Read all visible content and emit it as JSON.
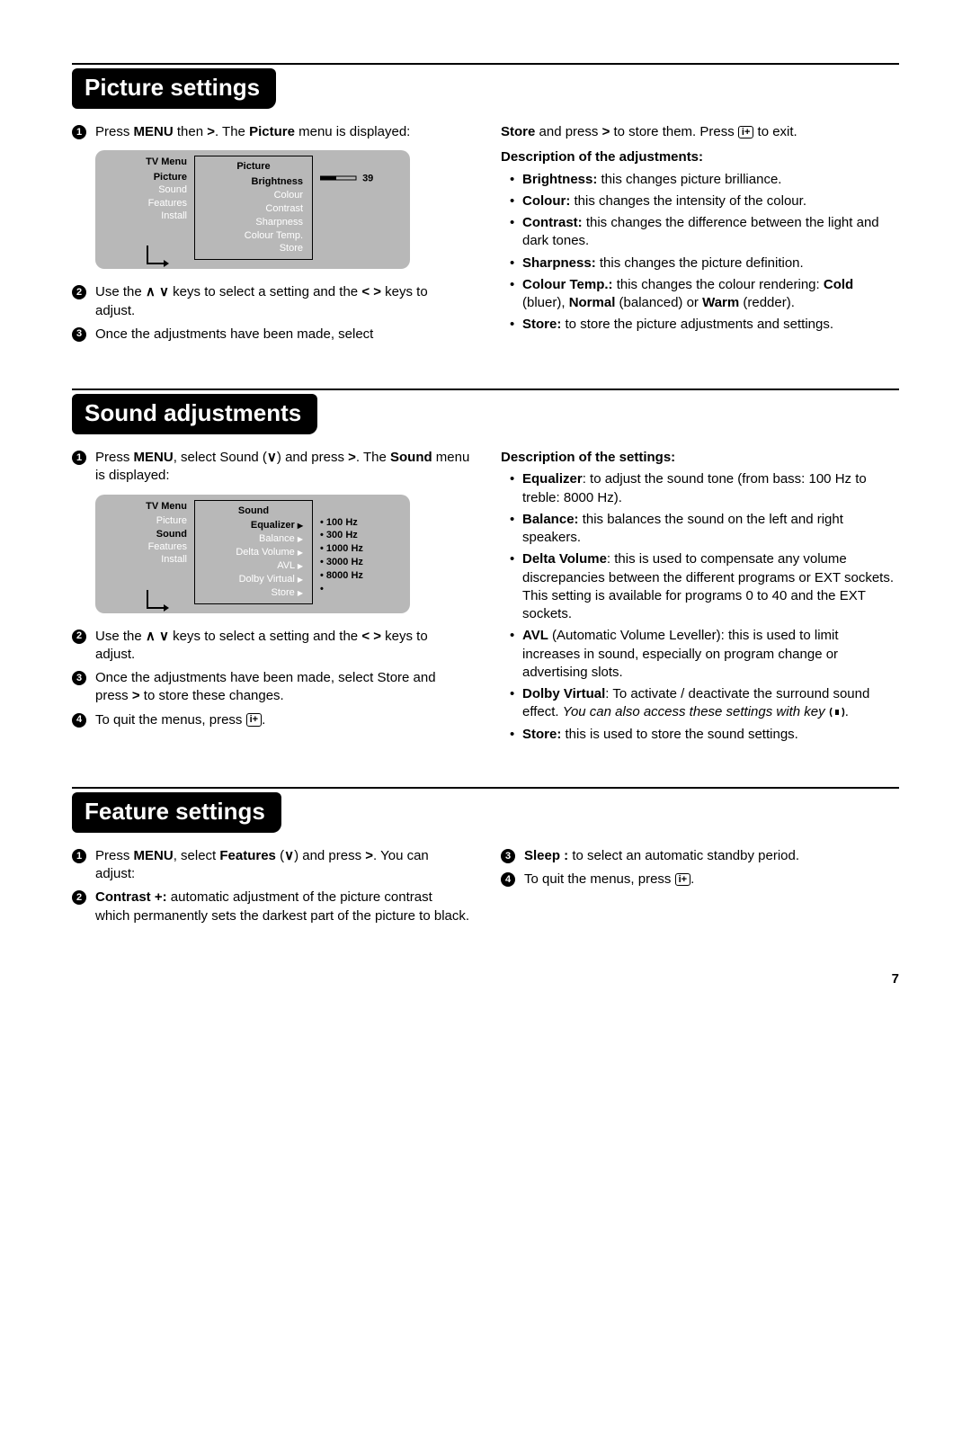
{
  "page_number": "7",
  "sections": {
    "picture": {
      "title": "Picture settings",
      "step1_a": "Press ",
      "step1_menu": "MENU",
      "step1_b": " then ",
      "step1_c": ". The ",
      "step1_picture": "Picture",
      "step1_d": " menu is displayed:",
      "osd": {
        "left_head": "TV Menu",
        "left_items": [
          "Picture",
          "Sound",
          "Features",
          "Install"
        ],
        "mid_head": "Picture",
        "mid_items": [
          "Brightness",
          "Colour",
          "Contrast",
          "Sharpness",
          "Colour Temp.",
          "Store"
        ],
        "value": "39"
      },
      "step2_a": "Use the ",
      "step2_b": " keys to select a setting and the ",
      "step2_c": " keys to adjust.",
      "step3": "Once the adjustments have been made, select",
      "step3_cont_a": " and press ",
      "step3_cont_b": " to store them. Press ",
      "step3_cont_c": " to exit.",
      "step3_store": "Store",
      "desc_head": "Description of the adjustments:",
      "desc": {
        "brightness_l": "Brightness:",
        "brightness_t": " this changes picture brilliance.",
        "colour_l": "Colour:",
        "colour_t": " this changes the intensity of the colour.",
        "contrast_l": "Contrast:",
        "contrast_t": " this changes the difference between the light and dark tones.",
        "sharpness_l": "Sharpness:",
        "sharpness_t": " this changes the picture definition.",
        "ctemp_l": "Colour Temp.:",
        "ctemp_t1": " this changes the colour rendering: ",
        "ctemp_cold": "Cold",
        "ctemp_t2": " (bluer), ",
        "ctemp_normal": "Normal",
        "ctemp_t3": " (balanced) or ",
        "ctemp_warm": "Warm",
        "ctemp_t4": " (redder).",
        "store_l": "Store:",
        "store_t": " to store the picture adjustments and settings."
      }
    },
    "sound": {
      "title": "Sound adjustments",
      "step1_a": "Press ",
      "step1_menu": "MENU",
      "step1_b": ", select Sound (",
      "step1_c": ") and press ",
      "step1_d": ". The ",
      "step1_sound": "Sound",
      "step1_e": " menu is displayed:",
      "osd": {
        "left_head": "TV Menu",
        "left_items": [
          "Picture",
          "Sound",
          "Features",
          "Install"
        ],
        "mid_head": "Sound",
        "mid_items": [
          "Equalizer",
          "Balance",
          "Delta Volume",
          "AVL",
          "Dolby Virtual",
          "Store"
        ],
        "hz": [
          "100 Hz",
          "300 Hz",
          "1000 Hz",
          "3000 Hz",
          "8000 Hz"
        ]
      },
      "step2_a": "Use the ",
      "step2_b": " keys to select a setting and the ",
      "step2_c": " keys to adjust.",
      "step3_a": "Once the adjustments have been made, select Store and press ",
      "step3_b": " to store these changes.",
      "step4_a": "To quit the menus, press ",
      "step4_b": ".",
      "desc_head": "Description of the settings:",
      "desc": {
        "eq_l": "Equalizer",
        "eq_t": ": to adjust the sound tone (from bass: 100 Hz to treble: 8000 Hz).",
        "bal_l": "Balance:",
        "bal_t": " this balances the sound on the left and right speakers.",
        "dv_l": "Delta Volume",
        "dv_t": ": this is used to compensate any volume discrepancies between the different programs or EXT sockets. This setting is available for programs 0 to 40 and the EXT sockets.",
        "avl_l": "AVL",
        "avl_t": " (Automatic Volume Leveller): this is used to limit increases in sound, especially on program change or advertising slots.",
        "dolby_l": "Dolby Virtual",
        "dolby_t1": ": To activate / deactivate the surround sound effect. ",
        "dolby_note": "You can also access these settings with key ",
        "dolby_t2": ".",
        "store_l": "Store:",
        "store_t": " this is used to store the sound settings."
      }
    },
    "feature": {
      "title": "Feature settings",
      "step1_a": "Press ",
      "step1_menu": "MENU",
      "step1_b": ", select ",
      "step1_features": "Features",
      "step1_c": " (",
      "step1_d": ") and press ",
      "step1_e": ". You can adjust:",
      "step2_l": "Contrast +:",
      "step2_t": " automatic adjustment of the picture contrast which permanently sets the darkest part of the picture to black.",
      "step3_l": "Sleep :",
      "step3_t": " to select an automatic standby period.",
      "step4_a": "To quit the menus, press ",
      "step4_b": "."
    }
  }
}
